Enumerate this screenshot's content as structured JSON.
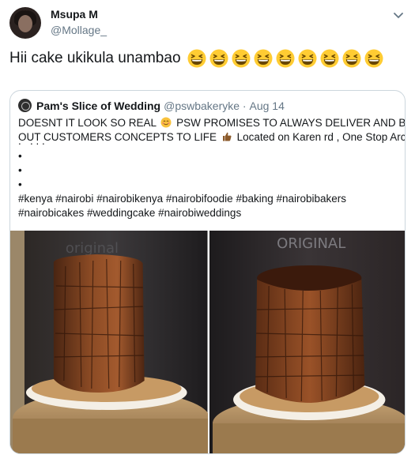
{
  "tweet": {
    "author_name": "Msupa M",
    "author_handle": "@Mollage_",
    "text": "Hii cake ukikula unambao",
    "emoji_count": 9,
    "emoji_icon": "grinning-squinting-face-icon"
  },
  "quoted_tweet": {
    "author_name": "Pam's Slice of Wedding",
    "author_handle": "@pswbakeryke",
    "date": "Aug 14",
    "line1_a": "DOESNT IT LOOK SO REAL",
    "line1_b": "PSW PROMISES TO ALWAYS DELIVER AND BRING",
    "line2_a": "OUT CUSTOMERS CONCEPTS TO LIFE",
    "line2_b": "Located on Karen rd , One Stop Arcade",
    "bullets": [
      "•",
      "•",
      "•"
    ],
    "hashtags_line1": "#kenya #nairobi #nairobikenya #nairobifoodie #baking #nairobibakers",
    "hashtags_line2": "#nairobicakes #weddingcake #nairobiweddings",
    "images": [
      {
        "icon": "tree-stump-cake-photo"
      },
      {
        "icon": "tree-stump-cake-photo"
      }
    ]
  },
  "colors": {
    "text": "#14171a",
    "secondary": "#657786",
    "border": "#ccd6dd"
  }
}
